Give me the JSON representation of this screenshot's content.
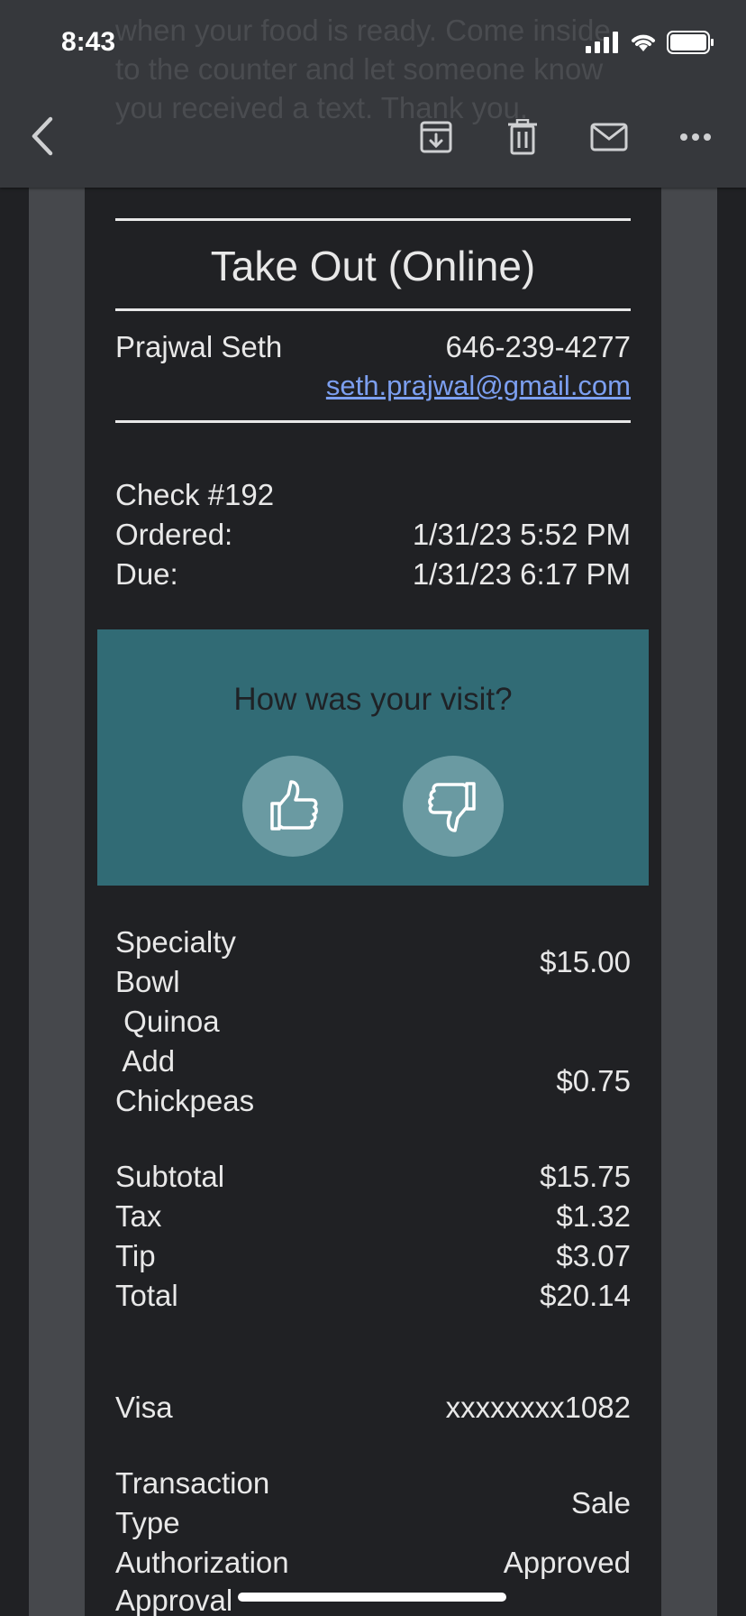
{
  "status_bar": {
    "time": "8:43"
  },
  "header": {
    "ghost_text": "when your food is ready. Come inside to the counter and let someone know you received a text. Thank you.",
    "back_icon": "chevron-left-icon",
    "actions": [
      "archive-icon",
      "trash-icon",
      "mail-icon",
      "more-icon"
    ]
  },
  "receipt": {
    "title": "Take Out (Online)",
    "customer": {
      "name": "Prajwal Seth",
      "phone": "646-239-4277",
      "email": "seth.prajwal@gmail.com"
    },
    "check": "Check #192",
    "ordered": {
      "label": "Ordered:",
      "value": "1/31/23 5:52 PM"
    },
    "due": {
      "label": "Due:",
      "value": "1/31/23 6:17 PM"
    },
    "feedback": {
      "question": "How was your visit?"
    },
    "items": [
      {
        "name_line1": "Specialty",
        "name_line2": "Bowl",
        "price": "$15.00"
      },
      {
        "name_line1": " Quinoa"
      },
      {
        "name_line1": " Add",
        "name_line2": "Chickpeas",
        "price": "$0.75"
      }
    ],
    "totals": {
      "subtotal": {
        "label": "Subtotal",
        "value": "$15.75"
      },
      "tax": {
        "label": "Tax",
        "value": "$1.32"
      },
      "tip": {
        "label": "Tip",
        "value": "$3.07"
      },
      "total": {
        "label": "Total",
        "value": "$20.14"
      }
    },
    "payment": {
      "card_label": "Visa",
      "card_number": "xxxxxxxx1082",
      "transaction_type_l1": "Transaction",
      "transaction_type_l2": "Type",
      "transaction_type_value": "Sale",
      "authorization_l1": "Authorization",
      "authorization_l2": "Approval",
      "authorization_value": "Approved"
    }
  },
  "colors": {
    "background": "#202124",
    "feedback_bg": "#316b75",
    "link": "#7c9ff0"
  }
}
